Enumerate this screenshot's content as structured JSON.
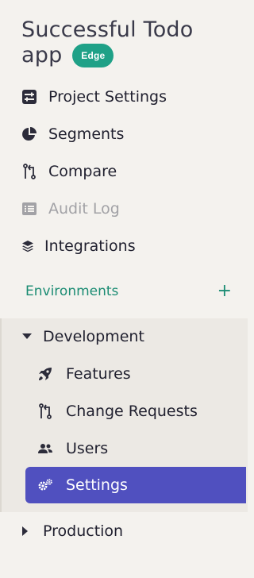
{
  "project": {
    "title_line1": "Successful Todo",
    "title_line2": "app",
    "badge": "Edge"
  },
  "nav": {
    "items": [
      {
        "label": "Project Settings",
        "icon": "sliders-icon",
        "disabled": false
      },
      {
        "label": "Segments",
        "icon": "pie-chart-icon",
        "disabled": false
      },
      {
        "label": "Compare",
        "icon": "compare-icon",
        "disabled": false
      },
      {
        "label": "Audit Log",
        "icon": "list-icon",
        "disabled": true
      },
      {
        "label": "Integrations",
        "icon": "layers-icon",
        "disabled": false
      }
    ]
  },
  "environments": {
    "header": "Environments",
    "add_symbol": "+",
    "list": [
      {
        "name": "Development",
        "expanded": true,
        "items": [
          {
            "label": "Features",
            "icon": "rocket-icon"
          },
          {
            "label": "Change Requests",
            "icon": "change-requests-icon"
          },
          {
            "label": "Users",
            "icon": "users-icon"
          },
          {
            "label": "Settings",
            "icon": "cogs-icon",
            "active": true
          }
        ]
      },
      {
        "name": "Production",
        "expanded": false
      }
    ]
  },
  "colors": {
    "background": "#f4f2ee",
    "accent_green": "#1fa187",
    "env_header": "#1b8c73",
    "active_bg": "#5050bf",
    "disabled_text": "#a2a2a6"
  }
}
